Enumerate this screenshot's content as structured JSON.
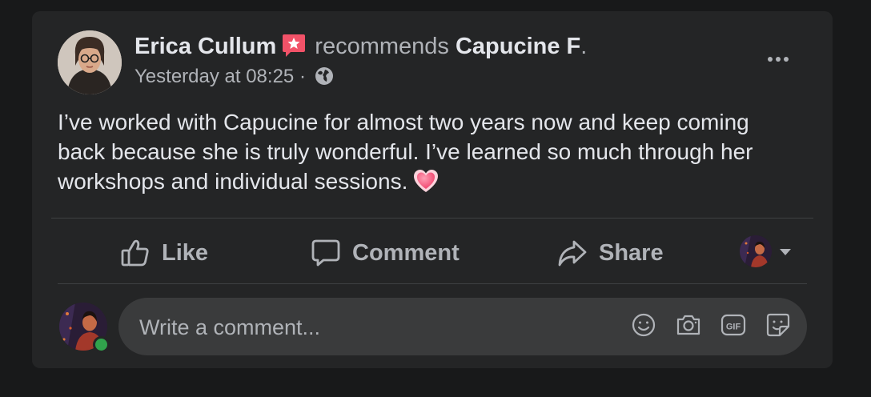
{
  "post": {
    "author": "Erica Cullum",
    "action_text": "recommends",
    "target": "Capucine F",
    "target_suffix": ".",
    "timestamp": "Yesterday at 08:25",
    "separator": "·",
    "audience_icon": "globe-icon",
    "body": "I’ve worked with Capucine for almost two years now and keep coming back because she is truly wonderful. I’ve learned so much through her workshops and individual sessions.",
    "emoji_icon": "sparkling-heart-icon"
  },
  "actions": {
    "like_label": "Like",
    "comment_label": "Comment",
    "share_label": "Share"
  },
  "comment": {
    "placeholder": "Write a comment..."
  },
  "colors": {
    "card_bg": "#242526",
    "page_bg": "#18191a",
    "text_primary": "#e4e6eb",
    "text_secondary": "#b0b3b8",
    "recommend_badge": "#f25268",
    "online": "#31a24c"
  }
}
